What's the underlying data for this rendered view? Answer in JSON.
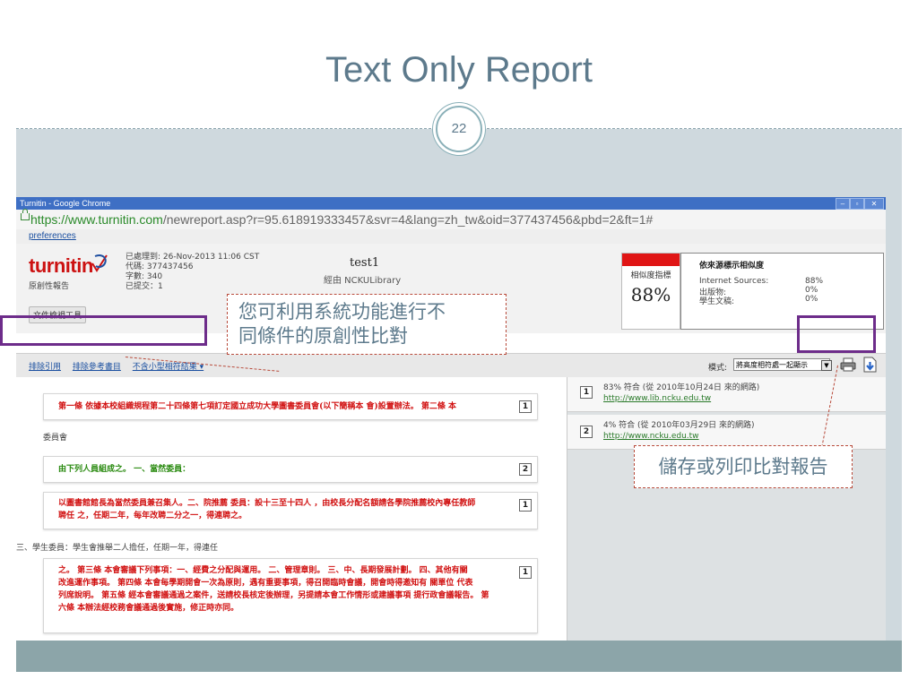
{
  "slide": {
    "title": "Text Only Report",
    "number": "22"
  },
  "browser": {
    "window_title": "Turnitin - Google Chrome",
    "url_host": "https://www.turnitin.com",
    "url_rest": "/newreport.asp?r=95.618919333457&svr=4&lang=zh_tw&oid=377437456&pbd=2&ft=1#",
    "preferences_link": "preferences"
  },
  "report": {
    "logo_text": "turnitin",
    "originality_label": "原創性報告",
    "meta_lines": [
      "已處理到: 26-Nov-2013 11:06 CST",
      "代碼: 377437456",
      "字數: 340",
      "已提交：1"
    ],
    "doc_title": "test1",
    "doc_via": "經由 NCKULibrary",
    "viewer_button": "文件檢視工具",
    "similarity_label": "相似度指標",
    "similarity_value": "88%",
    "sources_title": "依來源標示相似度",
    "sources": [
      {
        "label": "Internet Sources:",
        "value": "88%"
      },
      {
        "label": "出版物:",
        "value": "0%"
      },
      {
        "label": "學生文稿:",
        "value": "0%"
      }
    ]
  },
  "filter": {
    "links": [
      "排除引用",
      "排除參考書目",
      "不含小型相符結果 ▾"
    ],
    "mode_label": "模式:",
    "mode_value": "將高度相符處一起顯示"
  },
  "text_blocks": {
    "block1": "第一條 依據本校組織規程第二十四條第七項訂定國立成功大學圖書委員會(以下簡稱本 會)設置辦法。 第二條 本",
    "block1_num": "1",
    "plain1": "委員會",
    "block2": "由下列人員組成之。 一、當然委員：",
    "block2_num": "2",
    "block3_a": "以圖書館館長為當然委員兼召集人。二、院推薦 委員：設十三至十四人 ，由校長分配名額請各學院推薦校內專任教師",
    "block3_b": "聘任 之，任期二年，每年改聘二分之一，得連聘之。",
    "block3_num": "1",
    "plain2": "三、學生委員：學生會推舉二人擔任，任期一年，得連任",
    "block4_a": "之。 第三條 本會審議下列事項：一、經費之分配與運用。 二、管理章則。 三、中、長期發展計劃。 四、其他有關",
    "block4_b": "改進運作事項。 第四條 本會每學期開會一次為原則，遇有重要事項，得召開臨時會議，開會時得邀知有 關單位 代表",
    "block4_c": "列席說明。 第五條 經本會審議通過之案件，送請校長核定後辦理，另提請本會工作情形或建議事項 提行政會議報告。 第",
    "block4_d": "六條 本辦法經校務會議通過後實施，修正時亦同。",
    "block4_num": "1"
  },
  "match_sources": [
    {
      "num": "1",
      "summary": "83% 符合 (從 2010年10月24日 來的網路)",
      "link": "http://www.lib.ncku.edu.tw"
    },
    {
      "num": "2",
      "summary": "4% 符合 (從 2010年03月29日 來的網路)",
      "link": "http://www.ncku.edu.tw"
    }
  ],
  "annotations": {
    "compare_line1": "您可利用系統功能進行不",
    "compare_line2": "同條件的原創性比對",
    "save_print": "儲存或列印比對報告"
  },
  "colors": {
    "match_red": "#d11111",
    "match_green": "#2a8a10",
    "highlight_purple": "#6d2c8a",
    "title_color": "#5d7a8c"
  }
}
